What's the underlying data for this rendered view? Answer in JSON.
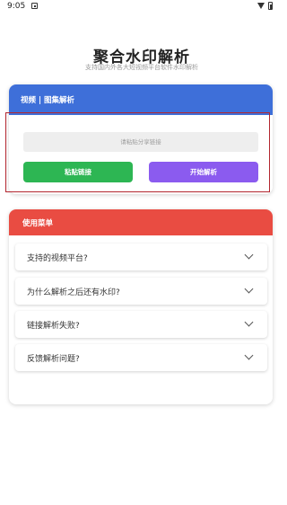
{
  "status_bar": {
    "time": "9:05"
  },
  "header": {
    "title": "聚合水印解析",
    "subtitle": "支持国内外各大短视频平台软件水印解析"
  },
  "parse_card": {
    "title": "视频 | 图集解析",
    "input_placeholder": "请粘贴分享链接",
    "input_value": "",
    "paste_button": "粘贴链接",
    "parse_button": "开始解析"
  },
  "menu_card": {
    "title": "使用菜单",
    "items": [
      {
        "question": "支持的视频平台?"
      },
      {
        "question": "为什么解析之后还有水印?"
      },
      {
        "question": "链接解析失败?"
      },
      {
        "question": "反馈解析问题?"
      }
    ]
  },
  "colors": {
    "parse_header": "#3e6fd9",
    "menu_header": "#e94c42",
    "paste_button": "#2db653",
    "parse_button": "#8b5bef",
    "highlight_border": "#b3262f"
  }
}
